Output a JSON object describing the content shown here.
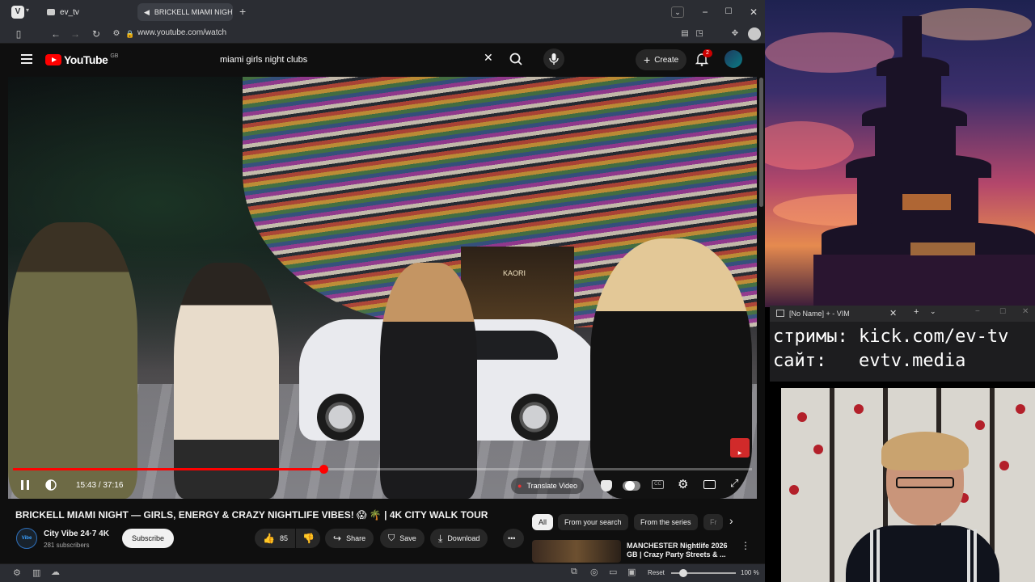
{
  "browser": {
    "tabs": [
      {
        "label": "ev_tv",
        "active": false
      },
      {
        "label": "BRICKELL MIAMI NIGHT —",
        "active": true
      }
    ],
    "url": "www.youtube.com/watch"
  },
  "youtube": {
    "logo_text": "YouTube",
    "logo_country": "GB",
    "search_value": "miami girls night clubs",
    "create_label": "Create",
    "notification_count": "2"
  },
  "video": {
    "current_time": "15:43",
    "duration": "37:16",
    "time_display": "15:43 / 37:16",
    "progress_fraction": 0.42,
    "translate_label": "Translate Video",
    "title": "BRICKELL MIAMI NIGHT — GIRLS, ENERGY & CRAZY NIGHTLIFE VIBES! 😱 🌴 | 4K CITY WALK TOUR",
    "storefront_sign": "KAORI"
  },
  "channel": {
    "name": "City Vibe 24·7 4K",
    "avatar_text": "Vibe",
    "subscribers": "281 subscribers",
    "subscribe_label": "Subscribe"
  },
  "actions": {
    "likes": "85",
    "share_label": "Share",
    "save_label": "Save",
    "download_label": "Download"
  },
  "chips": [
    {
      "label": "All",
      "active": true
    },
    {
      "label": "From your search",
      "active": false
    },
    {
      "label": "From the series",
      "active": false
    },
    {
      "label": "Fr",
      "active": false
    }
  ],
  "recommendation": {
    "title_line1": "MANCHESTER Nightlife 2026",
    "title_line2": "GB | Crazy Party Streets & ..."
  },
  "statusbar": {
    "reset_label": "Reset",
    "zoom": "100 %"
  },
  "vim": {
    "window_title": "[No Name] + - VIM",
    "line1": "стримы: kick.com/ev-tv",
    "line2": "сайт:   evtv.media"
  },
  "colors": {
    "yt_red": "#ff0000",
    "bg": "#0f0f0f",
    "chip_bg": "#272727"
  }
}
